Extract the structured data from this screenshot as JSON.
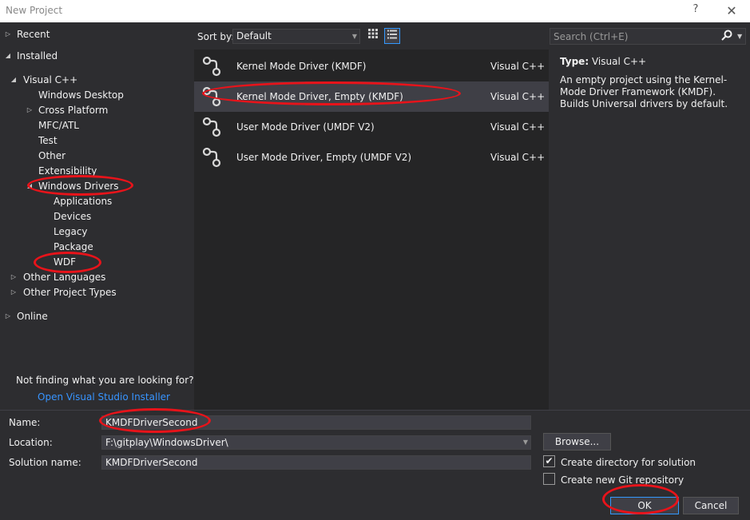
{
  "window": {
    "title": "New Project",
    "help": "?",
    "close": "✕"
  },
  "tree": {
    "recent": "Recent",
    "installed": "Installed",
    "visual_cpp": "Visual C++",
    "windows_desktop": "Windows Desktop",
    "cross_platform": "Cross Platform",
    "mfc_atl": "MFC/ATL",
    "test": "Test",
    "other": "Other",
    "extensibility": "Extensibility",
    "windows_drivers": "Windows Drivers",
    "applications": "Applications",
    "devices": "Devices",
    "legacy": "Legacy",
    "package": "Package",
    "wdf": "WDF",
    "other_languages": "Other Languages",
    "other_project_types": "Other Project Types",
    "online": "Online",
    "not_finding": "Not finding what you are looking for?",
    "installer_link": "Open Visual Studio Installer"
  },
  "sortbar": {
    "label": "Sort by:",
    "value": "Default"
  },
  "search": {
    "placeholder": "Search (Ctrl+E)"
  },
  "templates": [
    {
      "name": "Kernel Mode Driver (KMDF)",
      "lang": "Visual C++"
    },
    {
      "name": "Kernel Mode Driver, Empty (KMDF)",
      "lang": "Visual C++"
    },
    {
      "name": "User Mode Driver (UMDF V2)",
      "lang": "Visual C++"
    },
    {
      "name": "User Mode Driver, Empty (UMDF V2)",
      "lang": "Visual C++"
    }
  ],
  "details": {
    "type_label": "Type:",
    "type_value": "Visual C++",
    "description": "An empty project using the Kernel-Mode Driver Framework (KMDF). Builds Universal drivers by default."
  },
  "form": {
    "name_label": "Name:",
    "name_value": "KMDFDriverSecond",
    "location_label": "Location:",
    "location_value": "F:\\gitplay\\WindowsDriver\\",
    "solution_label": "Solution name:",
    "solution_value": "KMDFDriverSecond",
    "browse": "Browse...",
    "create_dir": "Create directory for solution",
    "create_git": "Create new Git repository",
    "ok": "OK",
    "cancel": "Cancel"
  },
  "annotation_color": "#e8131a",
  "accent_color": "#3399ff"
}
